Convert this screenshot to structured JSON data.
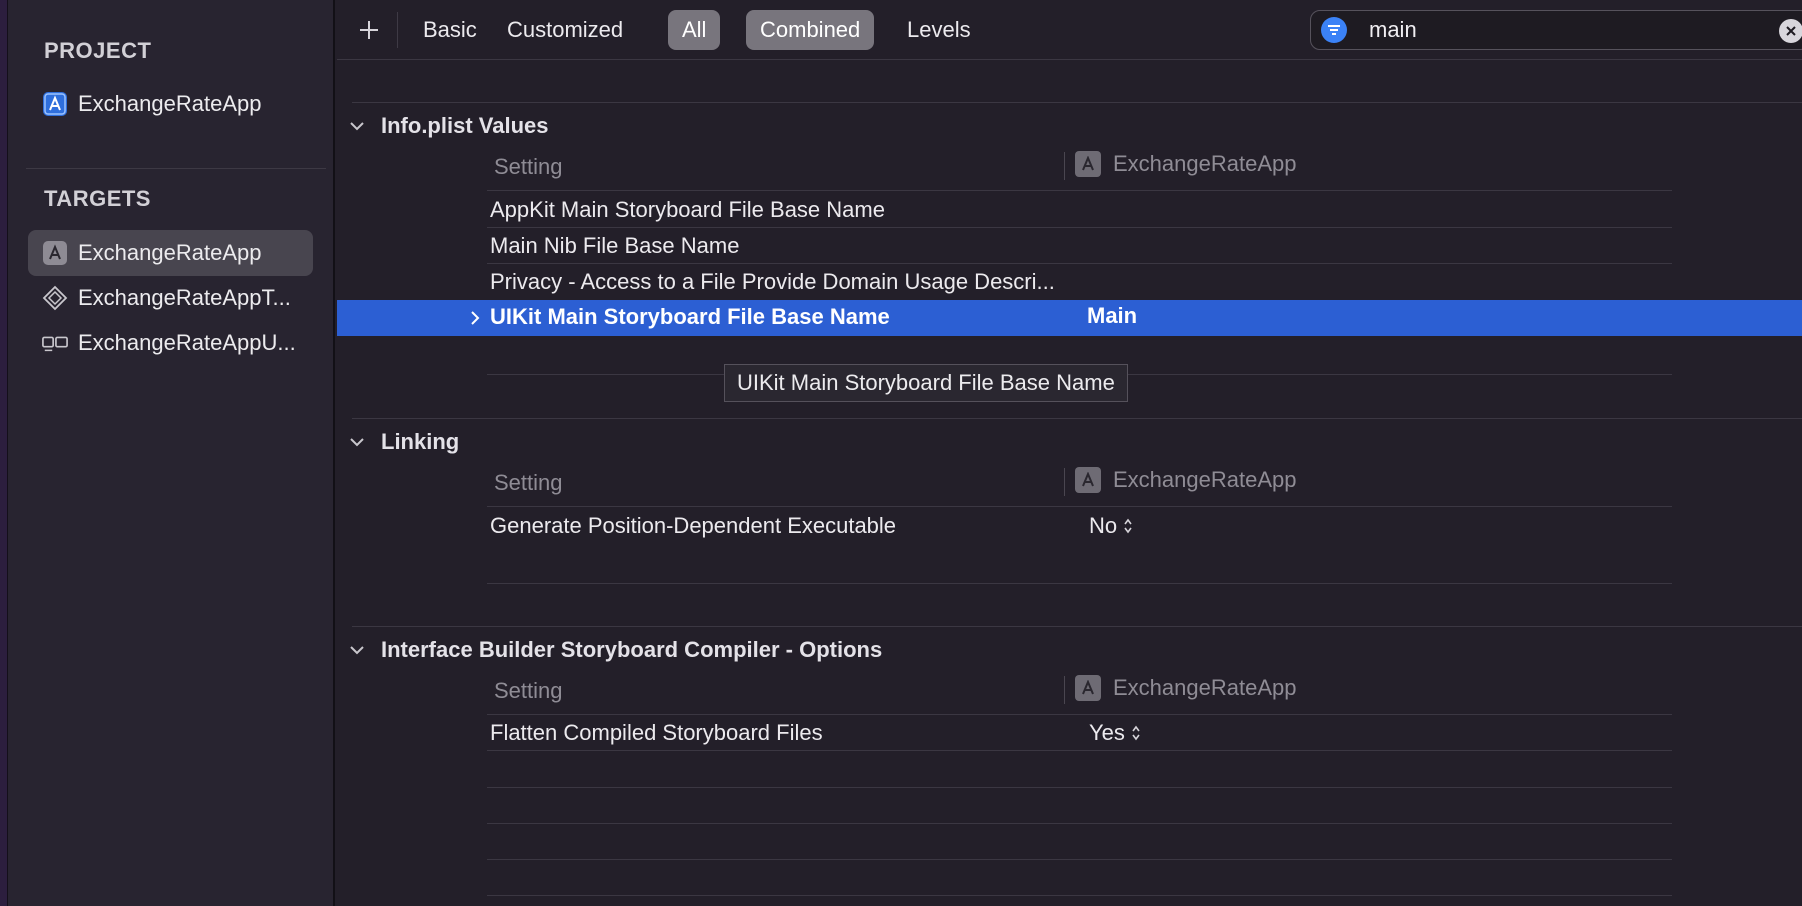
{
  "sidebar": {
    "project_title": "PROJECT",
    "project_item": "ExchangeRateApp",
    "targets_title": "TARGETS",
    "targets": [
      {
        "label": "ExchangeRateApp",
        "icon": "app-target-icon",
        "selected": true
      },
      {
        "label": "ExchangeRateAppT...",
        "icon": "unit-test-target-icon",
        "selected": false
      },
      {
        "label": "ExchangeRateAppU...",
        "icon": "ui-test-target-icon",
        "selected": false
      }
    ]
  },
  "toolbar": {
    "add_icon": "plus-icon",
    "filters": [
      "Basic",
      "Customized",
      "All"
    ],
    "views": [
      "Combined",
      "Levels"
    ],
    "active_filter": "All",
    "active_view": "Combined"
  },
  "search": {
    "value": "main",
    "filter_icon": "filter-icon",
    "clear_icon": "clear-icon"
  },
  "sections": [
    {
      "title": "Info.plist Values",
      "col_setting": "Setting",
      "col_target": "ExchangeRateApp",
      "rows": [
        {
          "name": "AppKit Main Storyboard File Base Name",
          "value": ""
        },
        {
          "name": "Main Nib File Base Name",
          "value": ""
        },
        {
          "name": "Privacy - Access to a File Provide Domain Usage Descri...",
          "value": ""
        },
        {
          "name": "UIKit Main Storyboard File Base Name",
          "value": "Main",
          "selected": true
        }
      ],
      "tooltip": "UIKit Main Storyboard File Base Name"
    },
    {
      "title": "Linking",
      "col_setting": "Setting",
      "col_target": "ExchangeRateApp",
      "rows": [
        {
          "name": "Generate Position-Dependent Executable",
          "value": "No"
        }
      ]
    },
    {
      "title": "Interface Builder Storyboard Compiler - Options",
      "col_setting": "Setting",
      "col_target": "ExchangeRateApp",
      "rows": [
        {
          "name": "Flatten Compiled Storyboard Files",
          "value": "Yes"
        }
      ]
    }
  ],
  "colors": {
    "selection": "#2c5fd3",
    "active_button": "#78757d",
    "search_filter": "#3b82f6"
  }
}
